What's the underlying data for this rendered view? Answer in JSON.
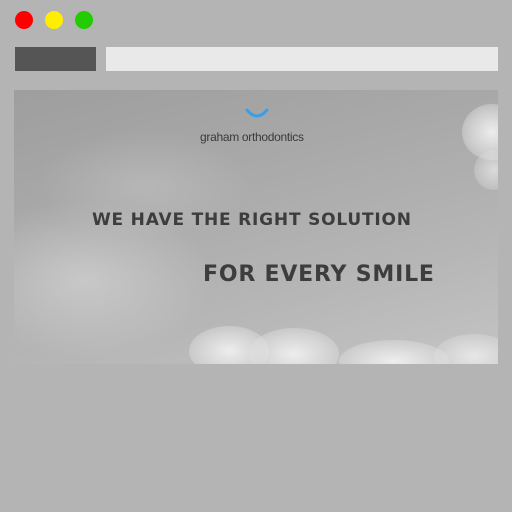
{
  "browser": {
    "traffic_lights": [
      {
        "name": "close",
        "color": "#ff0000"
      },
      {
        "name": "minimize",
        "color": "#ffee00"
      },
      {
        "name": "maximize",
        "color": "#22cc00"
      }
    ],
    "tab_color": "#555555",
    "address_bar_color": "#e9e9e9",
    "chrome_color": "#b4b4b4"
  },
  "hero": {
    "logo": {
      "icon": "smile-arc-icon",
      "accent_color": "#3a9ee8",
      "text": "graham orthodontics"
    },
    "headline_line_1": "WE HAVE THE RIGHT SOLUTION",
    "headline_line_2": "FOR EVERY SMILE",
    "text_color": "#3d3d3d",
    "background": "cloudy-sky"
  }
}
